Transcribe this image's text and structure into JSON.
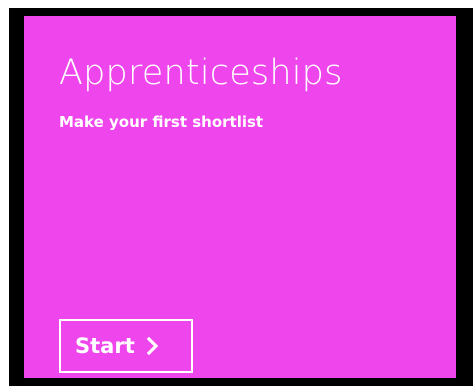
{
  "card": {
    "title": "Apprenticeships",
    "subtitle": "Make your first shortlist",
    "start_label": "Start",
    "start_icon": "chevron-right-icon",
    "background_color": "#ee45ec",
    "frame_color": "#000000",
    "text_color": "#ffffff"
  }
}
